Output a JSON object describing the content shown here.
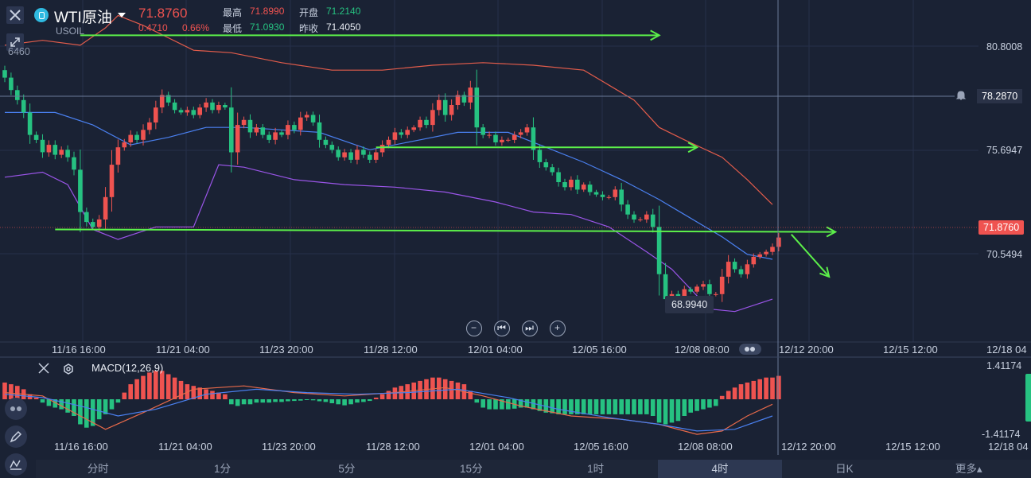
{
  "header": {
    "symbol_name": "WTI原油",
    "symbol_code": "USOIL",
    "last_price": "71.8760",
    "change": "0.4710",
    "change_pct": "0.66%",
    "high_label": "最高",
    "high_value": "71.8990",
    "open_label": "开盘",
    "open_value": "71.2140",
    "low_label": "最低",
    "low_value": "71.0930",
    "prev_close_label": "昨收",
    "prev_close_value": "71.4050"
  },
  "price_tags": {
    "top_partial": "6460",
    "axis_top": "80.8008",
    "alert": "78.2870",
    "axis_mid": "75.6947",
    "current": "71.8760",
    "axis_low": "70.5494",
    "low_marker": "68.9940"
  },
  "macd": {
    "title": "MACD(12,26,9)",
    "axis_top": "1.41174",
    "axis_bottom": "-1.41174"
  },
  "timeframe_tabs": [
    "分时",
    "1分",
    "5分",
    "15分",
    "1时",
    "4时",
    "日K",
    "更多▴"
  ],
  "active_tab": "4时",
  "colors": {
    "up": "#ef5350",
    "down": "#26c281",
    "background": "#1a2234",
    "trendline": "#5cf04a",
    "upper_band": "#e25c4b",
    "middle_band": "#4a80f0",
    "lower_band": "#9a55e8"
  },
  "chart_data": {
    "type": "candlestick",
    "title": "WTI原油",
    "timeframe": "4时",
    "xlabel": "",
    "ylabel": "",
    "ylim": [
      67.9,
      81.1
    ],
    "y_ticks": [
      80.8008,
      75.6947,
      70.5494
    ],
    "x_ticks": [
      "11/16 16:00",
      "11/21 04:00",
      "11/23 20:00",
      "11/28 12:00",
      "12/01 04:00",
      "12/05 16:00",
      "12/08 08:00",
      "12/12 20:00",
      "12/15 12:00",
      "12/18 04"
    ],
    "macd_x_ticks": [
      "11/16 16:00",
      "11/21 04:00",
      "11/23 20:00",
      "11/28 12:00",
      "12/01 04:00",
      "12/05 16:00",
      "12/08 08:00",
      "12/12 20:00",
      "12/15 12:00",
      "12/18 04"
    ],
    "grid": true,
    "candles_close": [
      78.3,
      77.8,
      77.4,
      76.9,
      76.0,
      75.8,
      75.3,
      75.6,
      75.2,
      75.4,
      75.1,
      74.6,
      72.9,
      72.5,
      72.3,
      72.6,
      73.5,
      74.8,
      75.5,
      75.7,
      76.0,
      75.8,
      76.2,
      76.5,
      77.1,
      77.6,
      77.3,
      77.0,
      76.9,
      77.0,
      76.8,
      77.1,
      77.3,
      77.0,
      77.2,
      77.1,
      75.3,
      76.4,
      76.6,
      76.1,
      76.3,
      76.0,
      75.8,
      76.1,
      76.0,
      76.4,
      76.2,
      76.7,
      76.8,
      76.5,
      75.8,
      75.6,
      75.4,
      75.1,
      75.3,
      75.0,
      75.4,
      75.2,
      75.0,
      75.3,
      75.6,
      75.8,
      76.1,
      76.0,
      76.2,
      76.3,
      76.6,
      76.4,
      77.0,
      77.4,
      76.8,
      77.2,
      77.6,
      77.3,
      77.9,
      76.3,
      76.0,
      76.0,
      75.7,
      75.8,
      75.8,
      76.0,
      76.1,
      76.3,
      75.4,
      74.9,
      74.7,
      74.5,
      74.1,
      73.9,
      74.2,
      73.8,
      74.0,
      73.7,
      73.6,
      73.5,
      73.5,
      73.8,
      73.2,
      72.8,
      72.6,
      72.6,
      72.8,
      72.3,
      70.4,
      69.4,
      69.6,
      69.5,
      69.8,
      69.7,
      69.9,
      70.0,
      69.6,
      69.6,
      70.3,
      70.9,
      70.6,
      70.4,
      70.8,
      71.1,
      71.2,
      71.3,
      71.5,
      71.876
    ],
    "volatility": [
      0.4,
      0.45,
      0.4,
      0.5,
      0.8,
      0.3,
      0.5,
      0.4,
      0.4,
      0.3,
      0.4,
      0.5,
      1.8,
      0.4,
      0.3,
      0.4,
      0.9,
      1.3,
      0.7,
      0.3,
      0.4,
      0.3,
      0.5,
      0.4,
      0.6,
      0.5,
      0.3,
      0.3,
      0.2,
      0.3,
      0.3,
      0.3,
      0.4,
      0.3,
      0.3,
      0.2,
      1.8,
      1.1,
      0.3,
      0.5,
      0.3,
      0.3,
      0.3,
      0.4,
      0.2,
      0.4,
      0.3,
      0.5,
      0.3,
      0.3,
      0.7,
      0.3,
      0.3,
      0.3,
      0.3,
      0.3,
      0.4,
      0.3,
      0.3,
      0.3,
      0.4,
      0.3,
      0.4,
      0.3,
      0.3,
      0.2,
      0.3,
      0.3,
      0.6,
      0.5,
      0.6,
      0.5,
      0.4,
      0.3,
      0.6,
      1.6,
      0.3,
      0.3,
      0.3,
      0.3,
      0.2,
      0.3,
      0.3,
      0.3,
      0.9,
      0.5,
      0.3,
      0.3,
      0.4,
      0.3,
      0.3,
      0.4,
      0.2,
      0.3,
      0.2,
      0.3,
      0.2,
      0.3,
      0.6,
      0.4,
      0.3,
      0.2,
      0.3,
      0.5,
      1.9,
      1.0,
      0.3,
      0.3,
      0.3,
      0.2,
      0.2,
      0.3,
      0.4,
      0.2,
      0.7,
      0.6,
      0.3,
      0.3,
      0.4,
      0.3,
      0.2,
      0.2,
      0.3,
      0.4
    ],
    "first_open": 78.6,
    "bollinger": {
      "upper": [
        [
          0,
          79.6
        ],
        [
          6,
          79.8
        ],
        [
          12,
          79.6
        ],
        [
          16,
          80.3
        ],
        [
          18,
          80.8
        ],
        [
          22,
          80.4
        ],
        [
          30,
          79.4
        ],
        [
          36,
          79.3
        ],
        [
          44,
          78.9
        ],
        [
          52,
          78.6
        ],
        [
          60,
          78.6
        ],
        [
          68,
          78.8
        ],
        [
          76,
          78.9
        ],
        [
          84,
          78.8
        ],
        [
          92,
          78.6
        ],
        [
          100,
          77.4
        ],
        [
          104,
          76.3
        ],
        [
          108,
          75.8
        ],
        [
          114,
          75.1
        ],
        [
          118,
          74.2
        ],
        [
          122,
          73.2
        ]
      ],
      "middle": [
        [
          0,
          76.9
        ],
        [
          8,
          76.9
        ],
        [
          14,
          76.4
        ],
        [
          20,
          75.6
        ],
        [
          26,
          75.9
        ],
        [
          32,
          76.3
        ],
        [
          38,
          76.3
        ],
        [
          44,
          76.2
        ],
        [
          50,
          76.1
        ],
        [
          58,
          75.4
        ],
        [
          66,
          75.8
        ],
        [
          72,
          76.1
        ],
        [
          80,
          76.1
        ],
        [
          86,
          75.5
        ],
        [
          92,
          74.9
        ],
        [
          98,
          74.2
        ],
        [
          104,
          73.4
        ],
        [
          108,
          72.8
        ],
        [
          114,
          71.9
        ],
        [
          118,
          71.2
        ],
        [
          122,
          71.0
        ]
      ],
      "lower": [
        [
          0,
          74.3
        ],
        [
          6,
          74.5
        ],
        [
          10,
          74.0
        ],
        [
          14,
          72.2
        ],
        [
          18,
          71.8
        ],
        [
          24,
          72.3
        ],
        [
          30,
          72.3
        ],
        [
          34,
          74.8
        ],
        [
          38,
          74.7
        ],
        [
          46,
          74.2
        ],
        [
          54,
          74.0
        ],
        [
          62,
          73.9
        ],
        [
          70,
          73.7
        ],
        [
          78,
          73.3
        ],
        [
          84,
          72.9
        ],
        [
          90,
          72.8
        ],
        [
          96,
          72.3
        ],
        [
          102,
          71.3
        ],
        [
          106,
          70.6
        ],
        [
          112,
          69.0
        ],
        [
          116,
          68.9
        ],
        [
          122,
          69.4
        ]
      ]
    },
    "trendlines": [
      {
        "x1": 12,
        "y1": 80.0,
        "x2": 104,
        "y2": 80.0
      },
      {
        "x1": 59,
        "y1": 75.5,
        "x2": 110,
        "y2": 75.5
      },
      {
        "x1": 8,
        "y1": 72.2,
        "x2": 132,
        "y2": 72.1
      },
      {
        "x1": 125,
        "y1": 72.0,
        "x2": 131,
        "y2": 70.3
      }
    ],
    "macd_hist": [
      0.5,
      0.45,
      0.4,
      0.3,
      0.15,
      0.05,
      -0.1,
      -0.2,
      -0.25,
      -0.3,
      -0.4,
      -0.5,
      -0.75,
      -0.85,
      -0.8,
      -0.6,
      -0.45,
      -0.3,
      -0.1,
      0.2,
      0.45,
      0.6,
      0.7,
      0.8,
      0.85,
      0.85,
      0.75,
      0.65,
      0.55,
      0.45,
      0.4,
      0.35,
      0.3,
      0.25,
      0.2,
      0.15,
      -0.15,
      -0.2,
      -0.15,
      -0.15,
      -0.1,
      -0.1,
      -0.1,
      -0.08,
      -0.08,
      -0.06,
      -0.05,
      -0.04,
      -0.02,
      -0.03,
      -0.06,
      -0.08,
      -0.12,
      -0.15,
      -0.18,
      -0.15,
      -0.1,
      -0.08,
      -0.05,
      0.05,
      0.15,
      0.25,
      0.35,
      0.4,
      0.45,
      0.5,
      0.55,
      0.6,
      0.65,
      0.65,
      0.6,
      0.55,
      0.5,
      0.45,
      0.25,
      -0.1,
      -0.25,
      -0.3,
      -0.3,
      -0.3,
      -0.3,
      -0.28,
      -0.25,
      -0.25,
      -0.3,
      -0.35,
      -0.4,
      -0.42,
      -0.45,
      -0.45,
      -0.45,
      -0.45,
      -0.45,
      -0.45,
      -0.45,
      -0.45,
      -0.45,
      -0.45,
      -0.45,
      -0.45,
      -0.45,
      -0.45,
      -0.45,
      -0.5,
      -0.7,
      -0.75,
      -0.7,
      -0.65,
      -0.5,
      -0.4,
      -0.35,
      -0.3,
      -0.25,
      -0.2,
      0.1,
      0.25,
      0.35,
      0.45,
      0.5,
      0.55,
      0.6,
      0.65,
      0.65,
      0.7
    ],
    "macd_dif": [
      [
        0,
        0.2
      ],
      [
        6,
        0.1
      ],
      [
        12,
        -0.5
      ],
      [
        16,
        -0.9
      ],
      [
        22,
        -0.4
      ],
      [
        30,
        0.3
      ],
      [
        38,
        0.4
      ],
      [
        46,
        0.2
      ],
      [
        54,
        0.1
      ],
      [
        62,
        0.2
      ],
      [
        70,
        0.35
      ],
      [
        76,
        0.1
      ],
      [
        82,
        -0.2
      ],
      [
        90,
        -0.5
      ],
      [
        98,
        -0.6
      ],
      [
        104,
        -0.75
      ],
      [
        110,
        -1.05
      ],
      [
        114,
        -0.95
      ],
      [
        118,
        -0.5
      ],
      [
        122,
        -0.15
      ]
    ],
    "macd_dea": [
      [
        0,
        0.15
      ],
      [
        6,
        0.05
      ],
      [
        12,
        -0.2
      ],
      [
        18,
        -0.5
      ],
      [
        24,
        -0.3
      ],
      [
        32,
        0.15
      ],
      [
        40,
        0.3
      ],
      [
        48,
        0.2
      ],
      [
        56,
        0.15
      ],
      [
        64,
        0.2
      ],
      [
        72,
        0.3
      ],
      [
        80,
        0.05
      ],
      [
        88,
        -0.3
      ],
      [
        96,
        -0.55
      ],
      [
        104,
        -0.75
      ],
      [
        110,
        -0.95
      ],
      [
        116,
        -0.9
      ],
      [
        122,
        -0.5
      ]
    ]
  }
}
